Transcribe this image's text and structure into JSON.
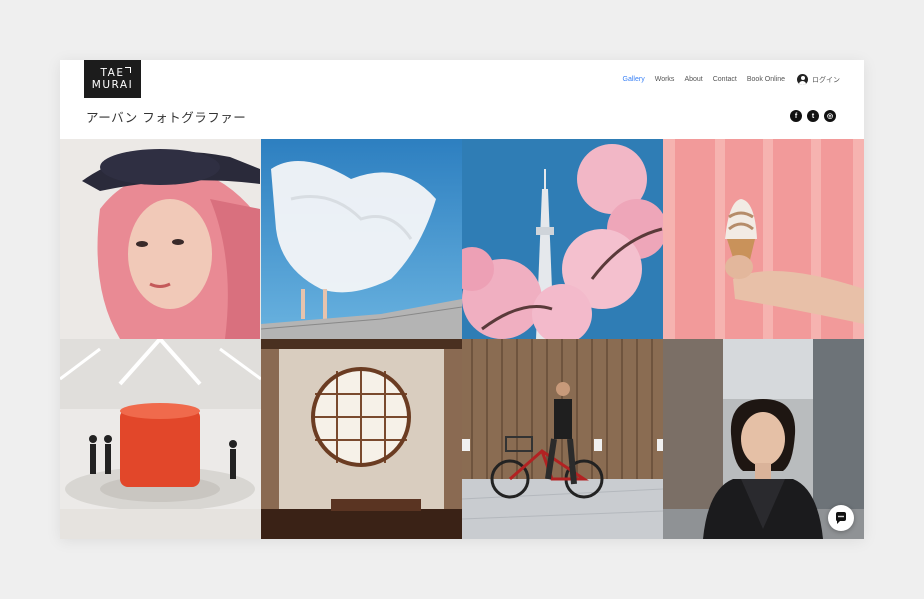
{
  "logo": {
    "line1": "TAE",
    "line2": "MURAI"
  },
  "nav": {
    "items": [
      "Gallery",
      "Works",
      "About",
      "Contact",
      "Book Online"
    ],
    "login_label": "ログイン",
    "accent": "#3b82f6"
  },
  "subtitle": "アーバン フォトグラファー",
  "social": [
    {
      "icon": "facebook-icon",
      "glyph": "f"
    },
    {
      "icon": "twitter-icon",
      "glyph": "t"
    },
    {
      "icon": "instagram-icon",
      "glyph": "◎"
    }
  ],
  "gallery": [
    "pink-hair-woman-photo",
    "white-dress-sky-photo",
    "skytree-cherry-blossom-photo",
    "ice-cream-pink-wall-photo",
    "orange-pillar-station-photo",
    "round-window-photo",
    "man-with-bicycle-photo",
    "woman-street-portrait-photo"
  ],
  "chat": {
    "icon": "chat-bubble-icon"
  }
}
